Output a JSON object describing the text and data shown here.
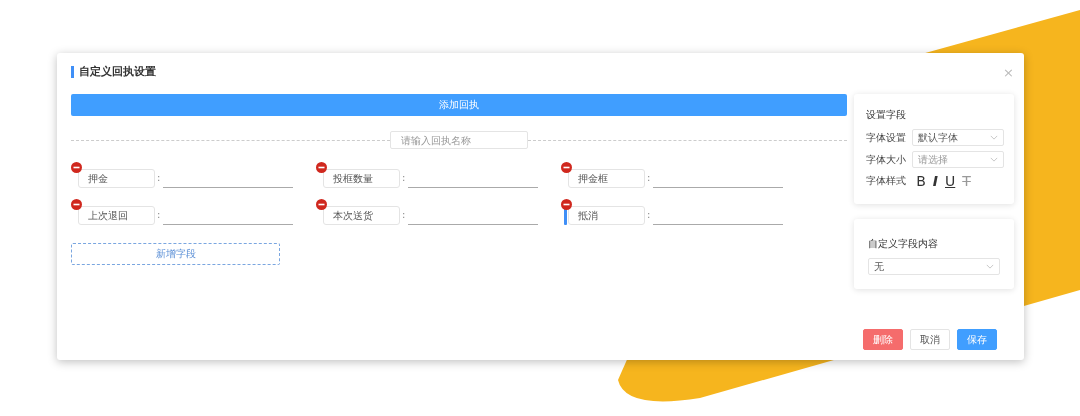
{
  "dialog": {
    "title": "自定义回执设置",
    "close": "×"
  },
  "add_button": "添加回执",
  "name_field": {
    "placeholder": "请输入回执名称"
  },
  "fields": [
    {
      "label": "押金",
      "separator": ":",
      "selected": false
    },
    {
      "label": "投框数量",
      "separator": ":",
      "selected": false
    },
    {
      "label": "押金框",
      "separator": ":",
      "selected": false
    },
    {
      "label": "上次退回",
      "separator": ":",
      "selected": false
    },
    {
      "label": "本次送货",
      "separator": ":",
      "selected": false
    },
    {
      "label": "抵消",
      "separator": ":",
      "selected": true
    }
  ],
  "new_field_button": "新增字段",
  "settings": {
    "title": "设置字段",
    "rows": [
      {
        "kind": "select",
        "label": "字体设置",
        "value": "默认字体"
      },
      {
        "kind": "select",
        "label": "字体大小",
        "placeholder": "请选择"
      },
      {
        "kind": "styles",
        "label": "字体样式",
        "buttons": [
          {
            "kind": "bold",
            "text": "B"
          },
          {
            "kind": "italic",
            "text": "I"
          },
          {
            "kind": "underline",
            "text": "U"
          },
          {
            "kind": "strike",
            "text": "T"
          }
        ]
      }
    ]
  },
  "custom_content": {
    "title": "自定义字段内容",
    "value": "无"
  },
  "footer": [
    {
      "kind": "danger",
      "label": "删除"
    },
    {
      "kind": "plain",
      "label": "取消"
    },
    {
      "kind": "primary",
      "label": "保存"
    }
  ]
}
